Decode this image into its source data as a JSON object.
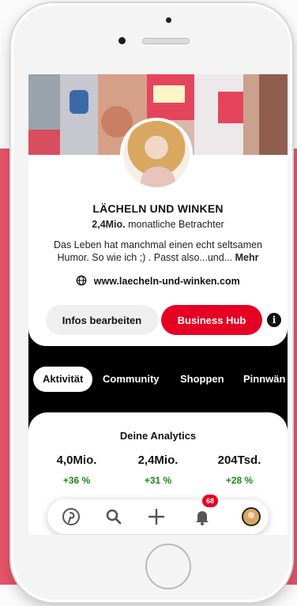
{
  "profile": {
    "name": "LÄCHELN UND WINKEN",
    "viewers_count": "2,4Mio.",
    "viewers_label": "monatliche Betrachter",
    "bio": "Das Leben hat manchmal einen echt seltsamen Humor. So wie ich ;) . Passt also...und...",
    "bio_more": "Mehr",
    "website": "www.laecheln-und-winken.com"
  },
  "actions": {
    "edit_label": "Infos bearbeiten",
    "hub_label": "Business Hub"
  },
  "tabs": [
    {
      "label": "Aktivität",
      "active": true
    },
    {
      "label": "Community",
      "active": false
    },
    {
      "label": "Shoppen",
      "active": false
    },
    {
      "label": "Pinnwän",
      "active": false
    }
  ],
  "analytics": {
    "title": "Deine Analytics",
    "stats": [
      {
        "value": "4,0Mio.",
        "change": "+36 %"
      },
      {
        "value": "2,4Mio.",
        "change": "+31 %"
      },
      {
        "value": "204Tsd.",
        "change": "+28 %"
      }
    ]
  },
  "nav": {
    "items": [
      "pinterest-icon",
      "search-icon",
      "plus-icon",
      "bell-icon",
      "avatar"
    ],
    "notification_count": "68"
  },
  "colors": {
    "accent": "#e60023",
    "background": "#e8566a",
    "positive": "#1a8a1a"
  }
}
